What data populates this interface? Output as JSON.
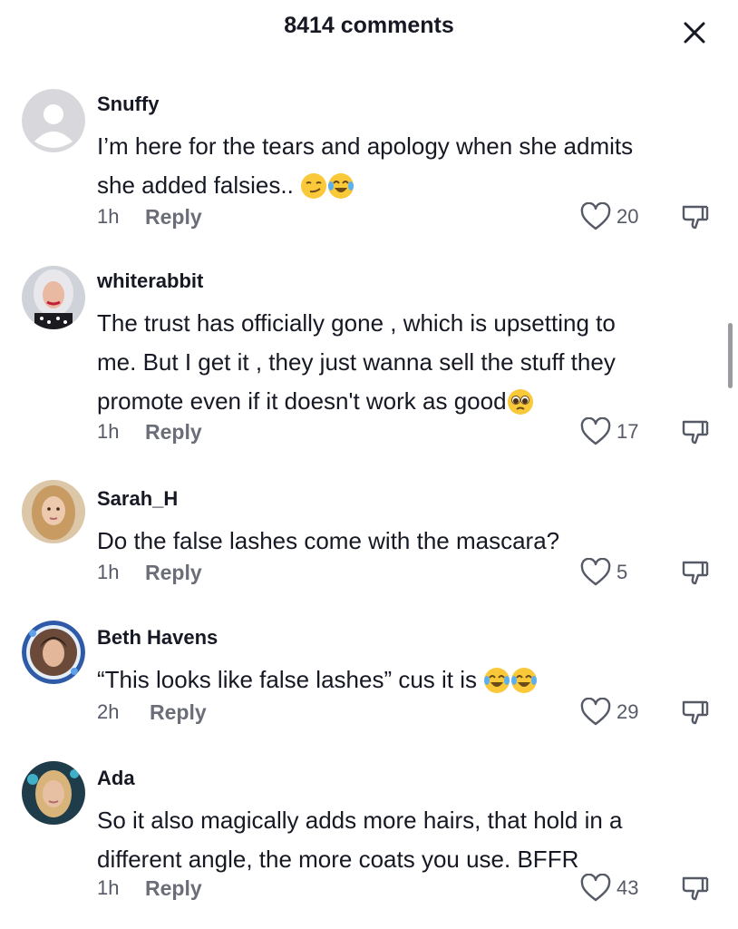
{
  "header": {
    "title": "8414 comments",
    "close_icon": "close-icon"
  },
  "comments": [
    {
      "username": "Snuffy",
      "text_lines": [
        "I’m here for the tears and apology when she admits",
        "she added falsies.."
      ],
      "emojis": [
        "smirking-face-emoji",
        "face-with-tears-of-joy-emoji"
      ],
      "time": "1h",
      "reply": "Reply",
      "likes": "20",
      "avatar": "default-avatar"
    },
    {
      "username": "whiterabbit",
      "text_lines": [
        "The trust has officially gone , which is upsetting to",
        "me. But I get it , they just wanna sell the stuff they",
        "promote even if it doesn't work as good"
      ],
      "emojis": [
        "pleading-face-emoji"
      ],
      "time": "1h",
      "reply": "Reply",
      "likes": "17",
      "avatar": "user-photo-avatar"
    },
    {
      "username": "Sarah_H",
      "text_lines": [
        "Do the false lashes come with the mascara?"
      ],
      "emojis": [],
      "time": "1h",
      "reply": "Reply",
      "likes": "5",
      "avatar": "user-photo-avatar"
    },
    {
      "username": "Beth Havens",
      "text_lines": [
        "“This looks like false lashes” cus it is"
      ],
      "emojis": [
        "face-with-tears-of-joy-emoji",
        "face-with-tears-of-joy-emoji"
      ],
      "time": "2h",
      "reply": "Reply",
      "likes": "29",
      "avatar": "user-photo-avatar"
    },
    {
      "username": "Ada",
      "text_lines": [
        "So it also magically adds more hairs, that hold in a",
        "different angle, the more coats you use. BFFR"
      ],
      "emojis": [],
      "time": "1h",
      "reply": "Reply",
      "likes": "43",
      "avatar": "user-photo-avatar"
    }
  ],
  "colors": {
    "text": "#161823",
    "muted": "#6b6e78",
    "emoji_yellow": "#f9c93a",
    "background": "#ffffff"
  }
}
